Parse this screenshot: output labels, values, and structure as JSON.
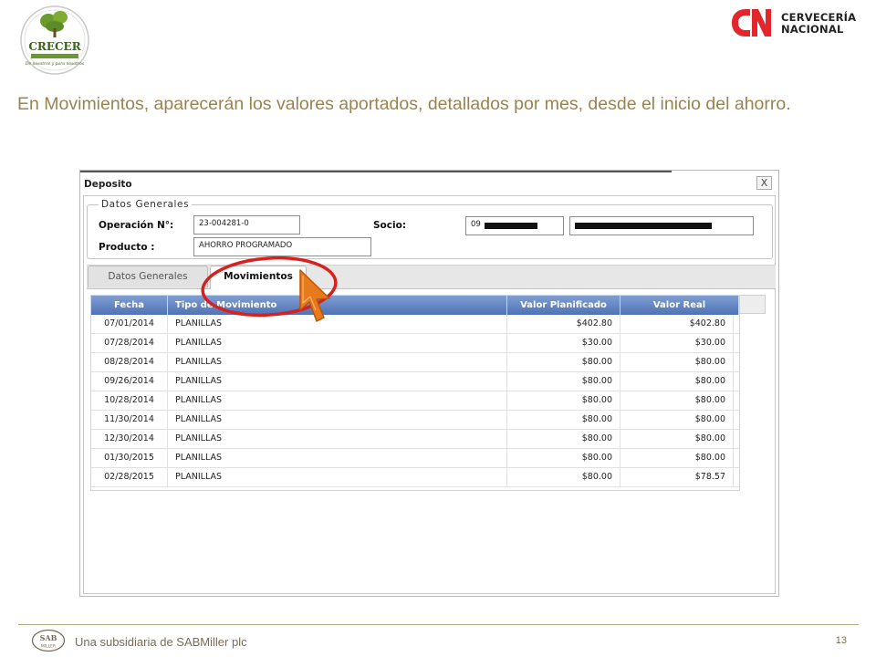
{
  "header": {
    "crecer_logo": {
      "name": "CRECER",
      "tagline": "De nosotros y para nosotros"
    },
    "brand": {
      "line1": "CERVECERÍA",
      "line2": "NACIONAL",
      "mark": "CN",
      "color": "#e2262b"
    }
  },
  "intro_text": "En Movimientos, aparecerán los valores aportados, detallados por mes, desde el inicio del ahorro.",
  "dialog": {
    "title": "Deposito",
    "close_label": "X",
    "fieldset_legend": "Datos Generales",
    "fields": {
      "operacion_label": "Operación N°:",
      "operacion_value": "23-004281-0",
      "producto_label": "Producto :",
      "producto_value": "AHORRO PROGRAMADO",
      "socio_label": "Socio:",
      "socio_value": "09"
    },
    "tabs": [
      {
        "label": "Datos Generales",
        "active": false
      },
      {
        "label": "Movimientos",
        "active": true
      }
    ],
    "grid": {
      "columns": [
        "Fecha",
        "Tipo de Movimiento",
        "Valor Planificado",
        "Valor Real"
      ],
      "rows": [
        {
          "fecha": "07/01/2014",
          "tipo": "PLANILLAS",
          "planificado": "$402.80",
          "real": "$402.80"
        },
        {
          "fecha": "07/28/2014",
          "tipo": "PLANILLAS",
          "planificado": "$30.00",
          "real": "$30.00"
        },
        {
          "fecha": "08/28/2014",
          "tipo": "PLANILLAS",
          "planificado": "$80.00",
          "real": "$80.00"
        },
        {
          "fecha": "09/26/2014",
          "tipo": "PLANILLAS",
          "planificado": "$80.00",
          "real": "$80.00"
        },
        {
          "fecha": "10/28/2014",
          "tipo": "PLANILLAS",
          "planificado": "$80.00",
          "real": "$80.00"
        },
        {
          "fecha": "11/30/2014",
          "tipo": "PLANILLAS",
          "planificado": "$80.00",
          "real": "$80.00"
        },
        {
          "fecha": "12/30/2014",
          "tipo": "PLANILLAS",
          "planificado": "$80.00",
          "real": "$80.00"
        },
        {
          "fecha": "01/30/2015",
          "tipo": "PLANILLAS",
          "planificado": "$80.00",
          "real": "$80.00"
        },
        {
          "fecha": "02/28/2015",
          "tipo": "PLANILLAS",
          "planificado": "$80.00",
          "real": "$78.57"
        }
      ]
    }
  },
  "annotation": {
    "highlight_color": "#d8201f",
    "pointer_color": "#e87a1e"
  },
  "footer": {
    "logo": "SAB MILLER",
    "text": "Una subsidiaria de SABMiller plc",
    "page_number": "13"
  }
}
